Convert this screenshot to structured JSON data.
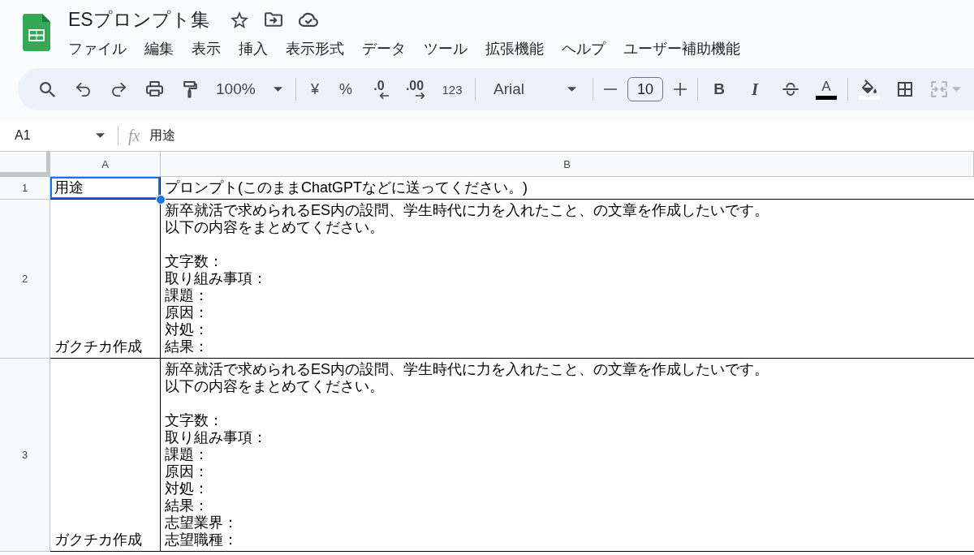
{
  "document": {
    "title": "ESプロンプト集"
  },
  "menu": [
    "ファイル",
    "編集",
    "表示",
    "挿入",
    "表示形式",
    "データ",
    "ツール",
    "拡張機能",
    "ヘルプ",
    "ユーザー補助機能"
  ],
  "toolbar": {
    "zoom": "100%",
    "currency": "¥",
    "percent": "%",
    "decrease_decimal": ".0",
    "increase_decimal": ".00",
    "number_format": "123",
    "font": "Arial",
    "font_size": "10",
    "bold": "B",
    "italic": "I",
    "text_color": {
      "label": "A",
      "color": "#000000"
    },
    "fill_color": {
      "color": "#ffffff"
    },
    "merge_cells": {
      "disabled": true
    }
  },
  "formula_bar": {
    "cell_ref": "A1",
    "fx": "fx",
    "value": "用途"
  },
  "sheet": {
    "columns": [
      "A",
      "B"
    ],
    "rows": [
      {
        "number": "1",
        "cells": [
          {
            "text": "用途",
            "selected": true
          },
          {
            "text": "プロンプト(このままChatGPTなどに送ってください。)",
            "selected": false
          }
        ]
      },
      {
        "number": "2",
        "cells": [
          {
            "text": "ガクチカ作成",
            "selected": false
          },
          {
            "paragraphs": [
              [
                "新卒就活で求められるES内の設問、学生時代に力を入れたこと、の文章を作成したいです。",
                "以下の内容をまとめてください。"
              ],
              [
                "文字数：",
                "取り組み事項：",
                "課題：",
                "原因：",
                "対処：",
                "結果："
              ]
            ],
            "selected": false
          }
        ]
      },
      {
        "number": "3",
        "cells": [
          {
            "text": "ガクチカ作成",
            "selected": false
          },
          {
            "paragraphs": [
              [
                "新卒就活で求められるES内の設問、学生時代に力を入れたこと、の文章を作成したいです。",
                "以下の内容をまとめてください。"
              ],
              [
                "文字数：",
                "取り組み事項：",
                "課題：",
                "原因：",
                "対処：",
                "結果：",
                "志望業界：",
                "志望職種："
              ]
            ],
            "selected": false
          }
        ]
      }
    ]
  }
}
